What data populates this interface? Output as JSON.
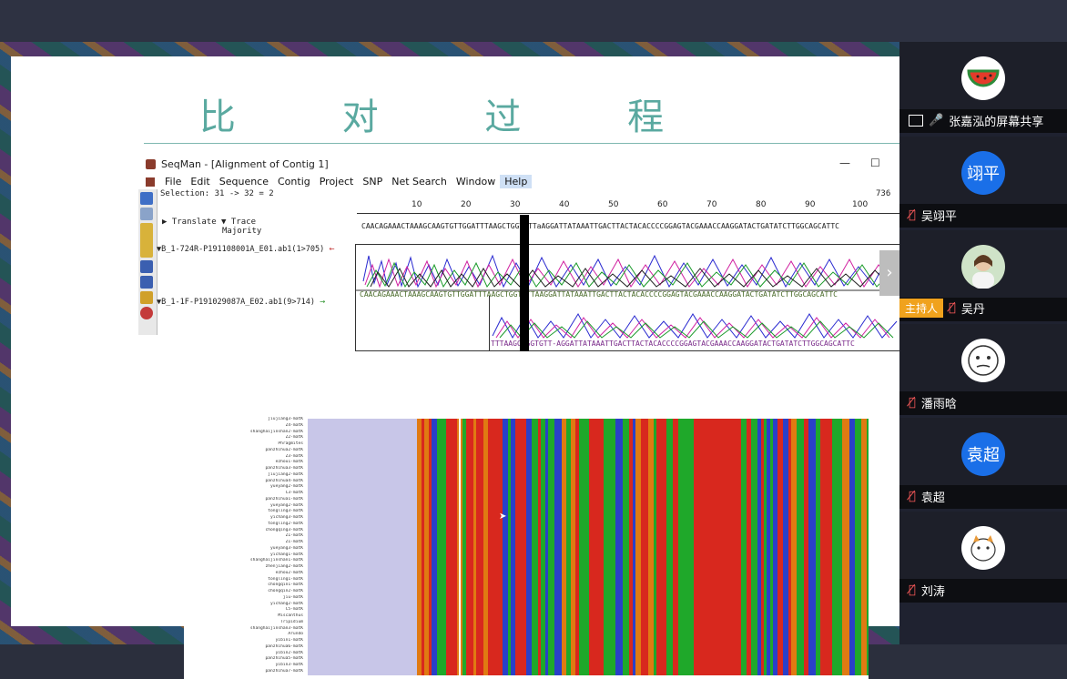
{
  "slide": {
    "title": "比 对 过 程"
  },
  "seqman": {
    "title": "SeqMan - [Alignment of Contig 1]",
    "controls": {
      "minimize": "—",
      "maximize": "☐"
    },
    "menu": [
      "File",
      "Edit",
      "Sequence",
      "Contig",
      "Project",
      "SNP",
      "Net Search",
      "Window",
      "Help"
    ],
    "active_menu": "Help",
    "selection": "Selection: 31 -> 32 = 2",
    "length": "736",
    "ruler_ticks": [
      "10",
      "20",
      "30",
      "40",
      "50",
      "60",
      "70",
      "80",
      "90",
      "100"
    ],
    "translate_label": "Translate",
    "trace_label": "Trace",
    "majority_label": "Majority",
    "consensus": "CAACAGAAACTAAAGCAAGTGTTGGATTTAAGCTGGTGTTaAGGATTATAAATTGACTTACTACACCCCGGAGTACGAAACCAAGGATACTGATATCTTGGCAGCATTC",
    "read1": {
      "name": "B_1-724R-P191108001A_E01.ab1(1>705)",
      "arrow": "←",
      "seq": "CAACAGAAACTAAAGCAAGTGTTGGATTTAAGCTGGTGTTAAGGATTATAAATTGACTTACTACACCCCGGAGTACGAAACCAAGGATACTGATATCTTGGCAGCATTC"
    },
    "read2": {
      "name": "B_1-1F-P191029087A_E02.ab1(9>714)",
      "arrow": "→",
      "seq": "TTTAAGCTGGTGTT-AGGATTATAAATTGACTTACTACACCCCGGAGTACGAAACCAAGGATACTGATATCTTGGCAGCATTC"
    }
  },
  "alignment": {
    "taxa": [
      "jiujiang3-matK",
      "Z4-matK",
      "shanghaijinshan2-matK",
      "Z2-matK",
      "Phragmites",
      "panzhihua2-matK",
      "Z3-matK",
      "ezhou1-matK",
      "panzhihua3-matK",
      "jiujiang2-matK",
      "panzhihua4-matK",
      "yueyang2-matK",
      "C3-matK",
      "panzhihua1-matK",
      "yueyang2-matK",
      "tongling3-matK",
      "yichang3-matK",
      "tongling2-matK",
      "chongqing3-matK",
      "Z1-matK",
      "Z1-matK",
      "yueyang3-matK",
      "yichang1-matK",
      "shanghaijinshan1-matK",
      "zhenjiang2-matK",
      "ezhou2-matK",
      "tongling1-matK",
      "chongqin1-matK",
      "chongqin2-matK",
      "jiu-matK",
      "yichang2-matK",
      "C5-matK",
      "Miscanthus",
      "Tripidium",
      "shanghaijinshan3-matK",
      "Arundo",
      "yibin1-matK",
      "panzhihua6-matK",
      "yibin2-matK",
      "panzhihua5-matK",
      "yibin3-matK",
      "panzhihua7-matK"
    ]
  },
  "participants": [
    {
      "name": "张嘉泓的屏幕共享",
      "avatar": "🍉",
      "status": "mic-on",
      "color": "#ffffff"
    },
    {
      "name": "吴翊平",
      "avatar": "翊平",
      "status": "mic-off",
      "color": "#1a6fe8"
    },
    {
      "name": "吴丹",
      "avatar": "",
      "status": "mic-off",
      "host_label": "主持人",
      "color": "#cfe3c8"
    },
    {
      "name": "潘雨晗",
      "avatar": "",
      "status": "mic-off",
      "color": "#ffffff"
    },
    {
      "name": "袁超",
      "avatar": "袁超",
      "status": "mic-off",
      "color": "#1a6fe8"
    },
    {
      "name": "刘涛",
      "avatar": "",
      "status": "mic-off",
      "color": "#ffffff"
    }
  ]
}
